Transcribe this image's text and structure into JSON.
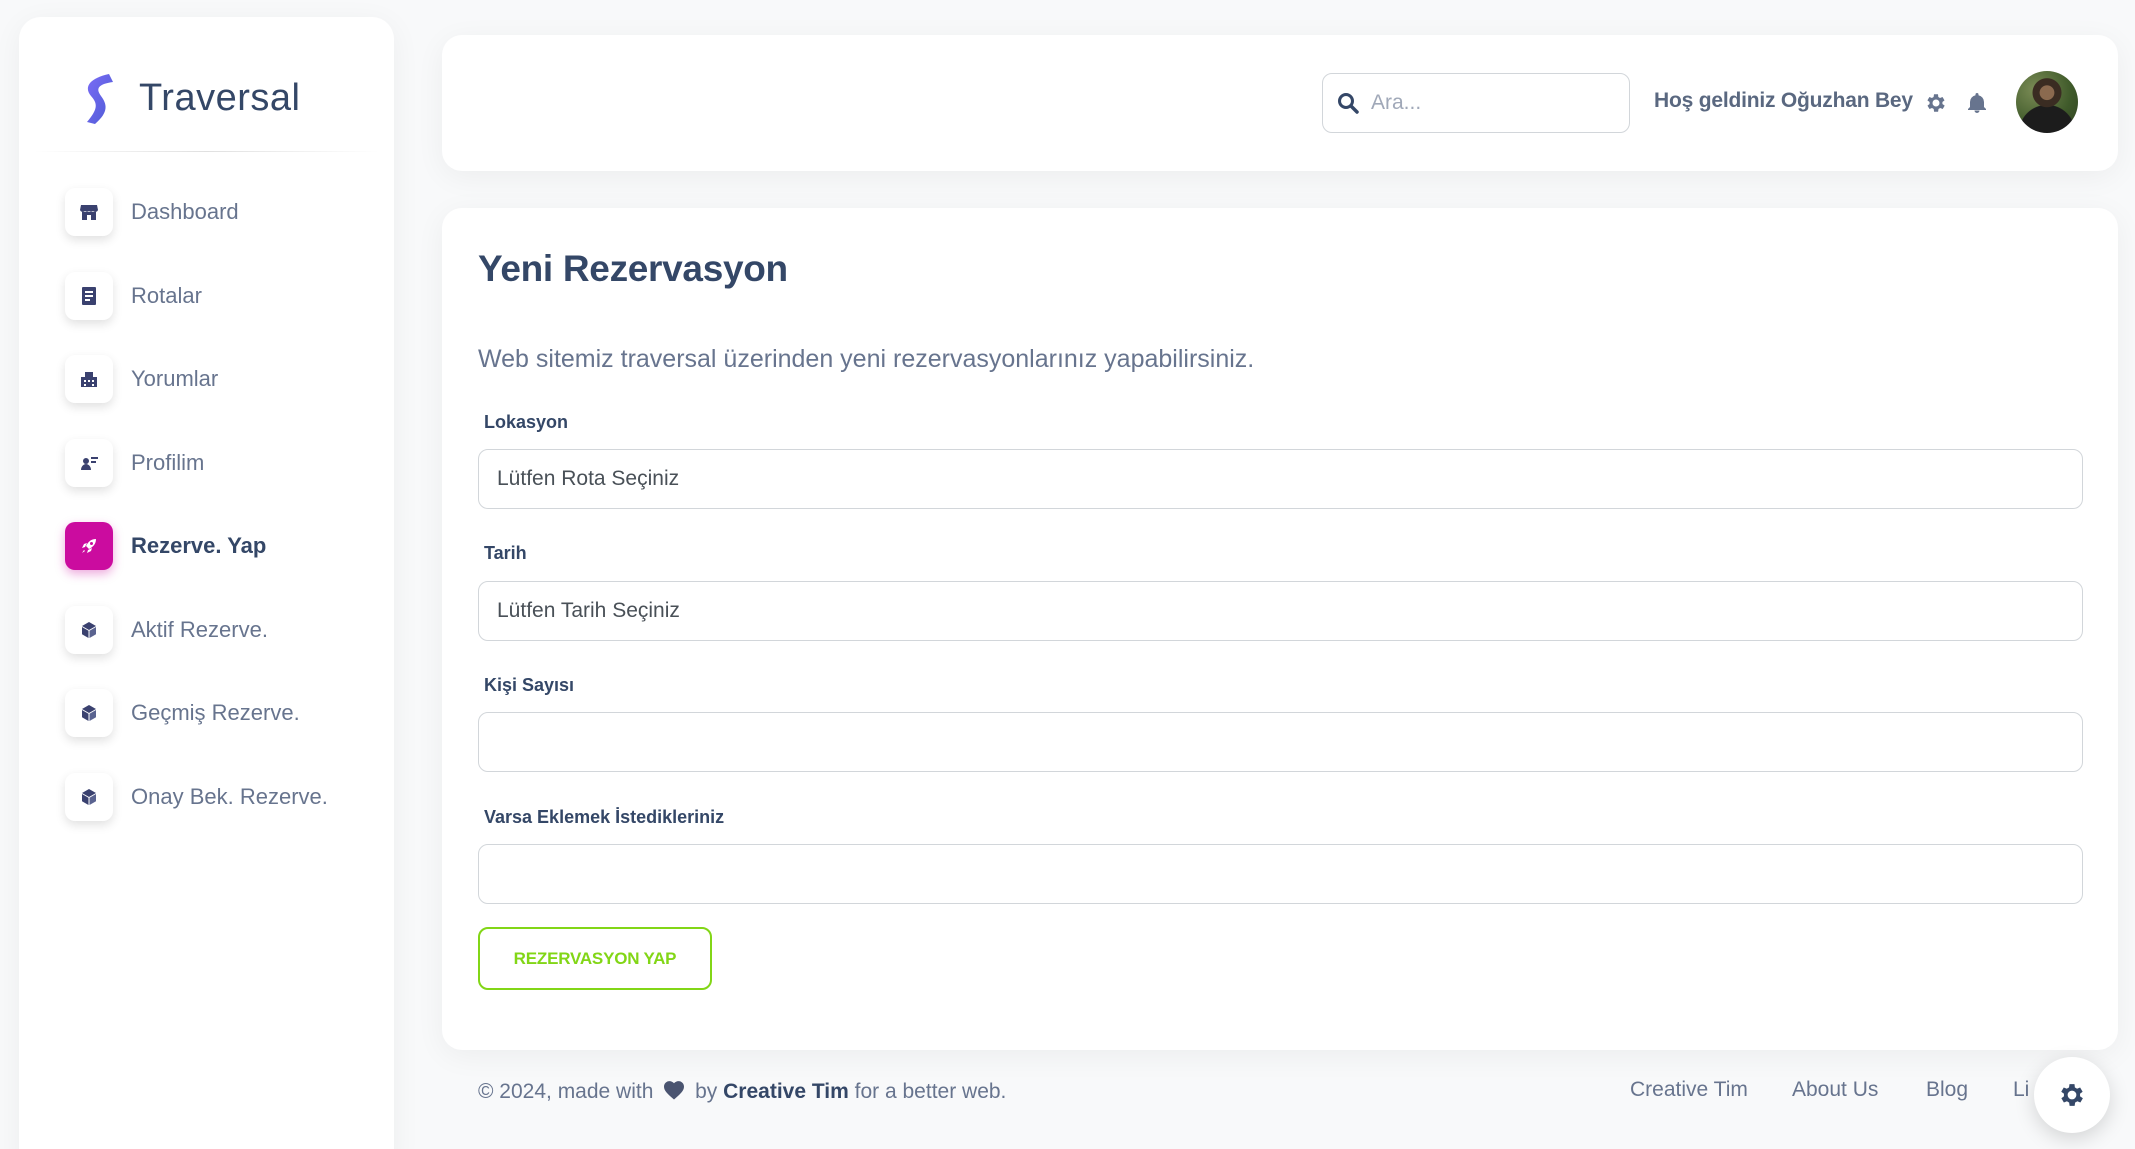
{
  "brand": {
    "name": "Traversal"
  },
  "sidebar": {
    "items": [
      {
        "label": "Dashboard",
        "icon": "shop-icon",
        "active": false
      },
      {
        "label": "Rotalar",
        "icon": "document-icon",
        "active": false
      },
      {
        "label": "Yorumlar",
        "icon": "office-icon",
        "active": false
      },
      {
        "label": "Profilim",
        "icon": "user-card-icon",
        "active": false
      },
      {
        "label": "Rezerve. Yap",
        "icon": "rocket-icon",
        "active": true
      },
      {
        "label": "Aktif Rezerve.",
        "icon": "box-icon",
        "active": false
      },
      {
        "label": "Geçmiş Rezerve.",
        "icon": "box-icon",
        "active": false
      },
      {
        "label": "Onay Bek. Rezerve.",
        "icon": "box-icon",
        "active": false
      }
    ],
    "active_color": "#cb0c9f"
  },
  "topbar": {
    "search_placeholder": "Ara...",
    "welcome": "Hoş geldiniz Oğuzhan Bey"
  },
  "form": {
    "title": "Yeni Rezervasyon",
    "description": "Web sitemiz traversal üzerinden yeni rezervasyonlarınız yapabilirsiniz.",
    "location_label": "Lokasyon",
    "location_value": "Lütfen Rota Seçiniz",
    "date_label": "Tarih",
    "date_value": "Lütfen Tarih Seçiniz",
    "people_label": "Kişi Sayısı",
    "people_value": "",
    "notes_label": "Varsa Eklemek İstedikleriniz",
    "notes_value": "",
    "submit_label": "REZERVASYON YAP",
    "submit_color": "#82d616"
  },
  "footer": {
    "copyright_prefix": "© 2024, made with",
    "by": "by",
    "author": "Creative Tim",
    "suffix": "for a better web.",
    "links": [
      "Creative Tim",
      "About Us",
      "Blog",
      "Li"
    ]
  }
}
